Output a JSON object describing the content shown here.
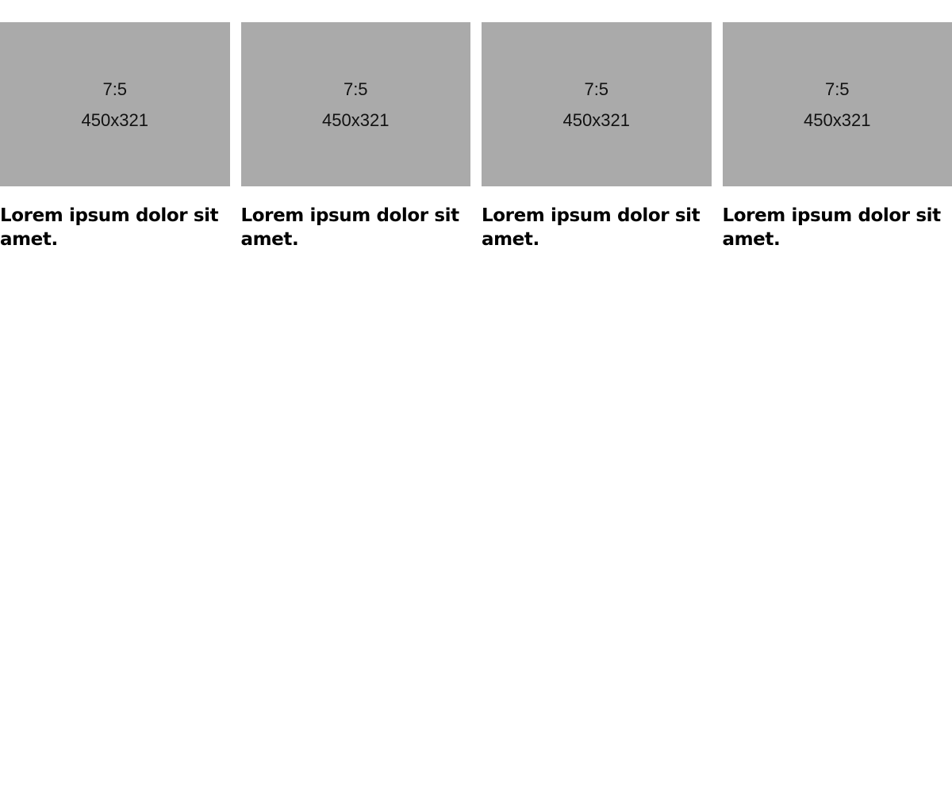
{
  "colors": {
    "placeholder_bg": "#aaaaaa",
    "text": "#000000",
    "background": "#ffffff"
  },
  "cards": [
    {
      "ratio": "7:5",
      "dimensions": "450x321",
      "title": "Lorem ipsum dolor sit amet."
    },
    {
      "ratio": "7:5",
      "dimensions": "450x321",
      "title": "Lorem ipsum dolor sit amet."
    },
    {
      "ratio": "7:5",
      "dimensions": "450x321",
      "title": "Lorem ipsum dolor sit amet."
    },
    {
      "ratio": "7:5",
      "dimensions": "450x321",
      "title": "Lorem ipsum dolor sit amet."
    }
  ]
}
